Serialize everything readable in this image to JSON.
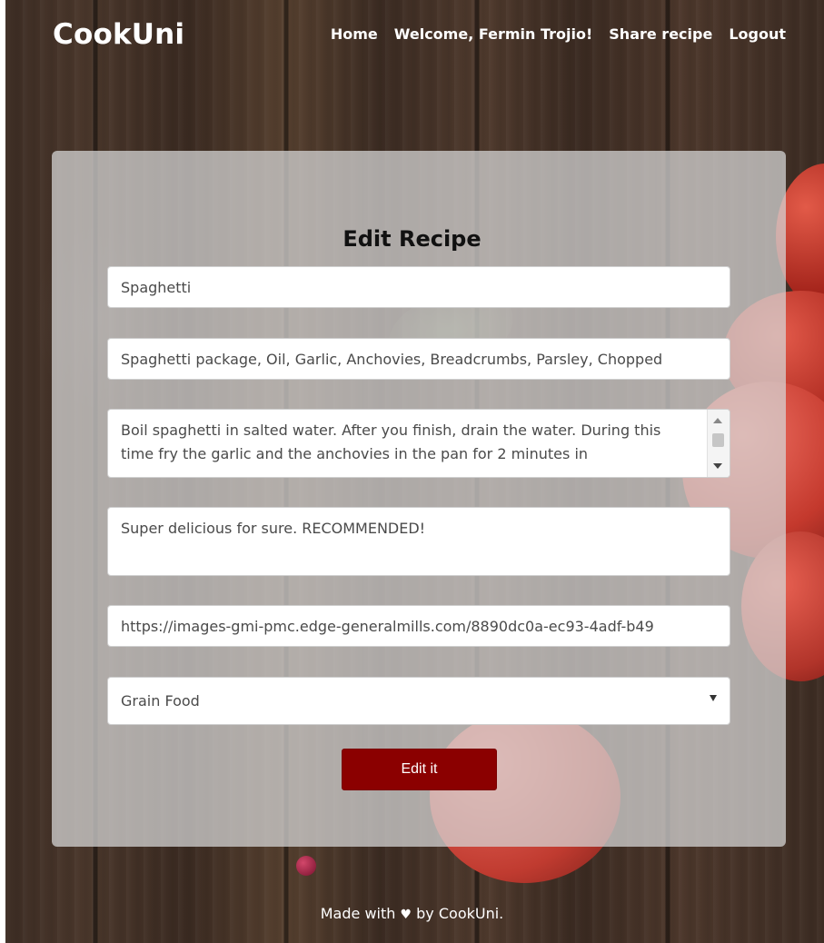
{
  "navbar": {
    "brand": "CookUni",
    "links": {
      "home": "Home",
      "welcome": "Welcome, Fermin Trojio!",
      "share": "Share recipe",
      "logout": "Logout"
    }
  },
  "form": {
    "title": "Edit Recipe",
    "fields": {
      "meal": "Spaghetti",
      "ingredients": "Spaghetti package, Oil, Garlic, Anchovies, Breadcrumbs, Parsley, Chopped",
      "preparation": "Boil spaghetti in salted water. After you finish, drain the water. During this time fry the garlic and the anchovies in the pan for 2 minutes in",
      "description": "Super delicious for sure. RECOMMENDED!",
      "image_url": "https://images-gmi-pmc.edge-generalmills.com/8890dc0a-ec93-4adf-b49",
      "category": "Grain Food"
    },
    "submit_label": "Edit it"
  },
  "footer": {
    "prefix": "Made with",
    "heart_icon": "♥",
    "suffix": "by CookUni."
  }
}
